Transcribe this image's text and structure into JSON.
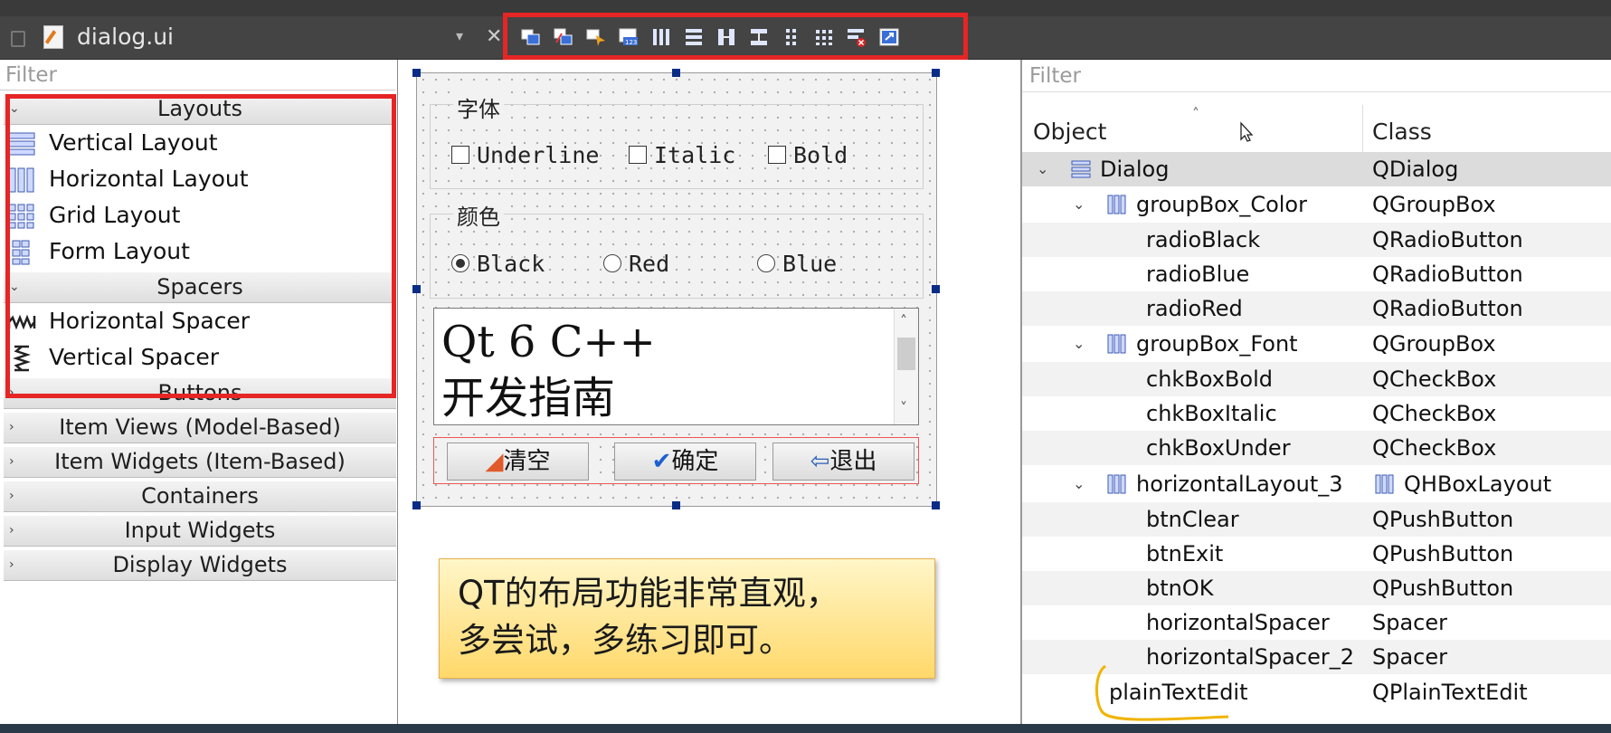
{
  "window": {
    "tab_title": "dialog.ui"
  },
  "widget_box": {
    "filter_placeholder": "Filter",
    "categories": [
      {
        "label": "Layouts",
        "expanded": true,
        "items": [
          "Vertical Layout",
          "Horizontal Layout",
          "Grid Layout",
          "Form Layout"
        ]
      },
      {
        "label": "Spacers",
        "expanded": true,
        "items": [
          "Horizontal Spacer",
          "Vertical Spacer"
        ]
      },
      {
        "label": "Buttons",
        "expanded": false
      },
      {
        "label": "Item Views (Model-Based)",
        "expanded": false
      },
      {
        "label": "Item Widgets (Item-Based)",
        "expanded": false
      },
      {
        "label": "Containers",
        "expanded": false
      },
      {
        "label": "Input Widgets",
        "expanded": false
      },
      {
        "label": "Display Widgets",
        "expanded": false
      }
    ]
  },
  "form": {
    "font_group": {
      "title": "字体",
      "checkboxes": [
        "Underline",
        "Italic",
        "Bold"
      ]
    },
    "color_group": {
      "title": "颜色",
      "radios": [
        "Black",
        "Red",
        "Blue"
      ],
      "checked": "Black"
    },
    "plain_text": {
      "line1": "Qt 6 C++",
      "line2": "开发指南"
    },
    "buttons": {
      "clear": "清空",
      "ok": "确定",
      "exit": "退出"
    }
  },
  "note": {
    "line1": "QT的布局功能非常直观，",
    "line2": "多尝试，多练习即可。"
  },
  "object_inspector": {
    "filter_placeholder": "Filter",
    "columns": {
      "object": "Object",
      "class": "Class"
    },
    "rows": [
      {
        "object": "Dialog",
        "class": "QDialog",
        "level": 0,
        "expand": true,
        "icon": "vertical-layout-icon"
      },
      {
        "object": "groupBox_Color",
        "class": "QGroupBox",
        "level": 1,
        "expand": true,
        "icon": "horizontal-layout-icon"
      },
      {
        "object": "radioBlack",
        "class": "QRadioButton",
        "level": 2
      },
      {
        "object": "radioBlue",
        "class": "QRadioButton",
        "level": 2
      },
      {
        "object": "radioRed",
        "class": "QRadioButton",
        "level": 2
      },
      {
        "object": "groupBox_Font",
        "class": "QGroupBox",
        "level": 1,
        "expand": true,
        "icon": "horizontal-layout-icon"
      },
      {
        "object": "chkBoxBold",
        "class": "QCheckBox",
        "level": 2
      },
      {
        "object": "chkBoxItalic",
        "class": "QCheckBox",
        "level": 2
      },
      {
        "object": "chkBoxUnder",
        "class": "QCheckBox",
        "level": 2
      },
      {
        "object": "horizontalLayout_3",
        "class": "QHBoxLayout",
        "level": 1,
        "expand": true,
        "icon": "horizontal-layout-icon",
        "class_icon": true
      },
      {
        "object": "btnClear",
        "class": "QPushButton",
        "level": 2
      },
      {
        "object": "btnExit",
        "class": "QPushButton",
        "level": 2
      },
      {
        "object": "btnOK",
        "class": "QPushButton",
        "level": 2
      },
      {
        "object": "horizontalSpacer",
        "class": "Spacer",
        "level": 2
      },
      {
        "object": "horizontalSpacer_2",
        "class": "Spacer",
        "level": 2
      },
      {
        "object": "plainTextEdit",
        "class": "QPlainTextEdit",
        "level": 2
      }
    ]
  },
  "colors": {
    "highlight_box": "#e62525",
    "note_bg": "#ffd86a",
    "selection_handle": "#0b2c86"
  },
  "toolbar_icons": [
    "edit-widgets-icon",
    "edit-signals-icon",
    "edit-buddies-icon",
    "edit-tab-order-icon",
    "lay-out-horizontally-icon",
    "lay-out-vertically-icon",
    "lay-out-horizontal-splitter-icon",
    "lay-out-vertical-splitter-icon",
    "lay-out-form-icon",
    "lay-out-grid-icon",
    "break-layout-icon",
    "adjust-size-icon"
  ]
}
